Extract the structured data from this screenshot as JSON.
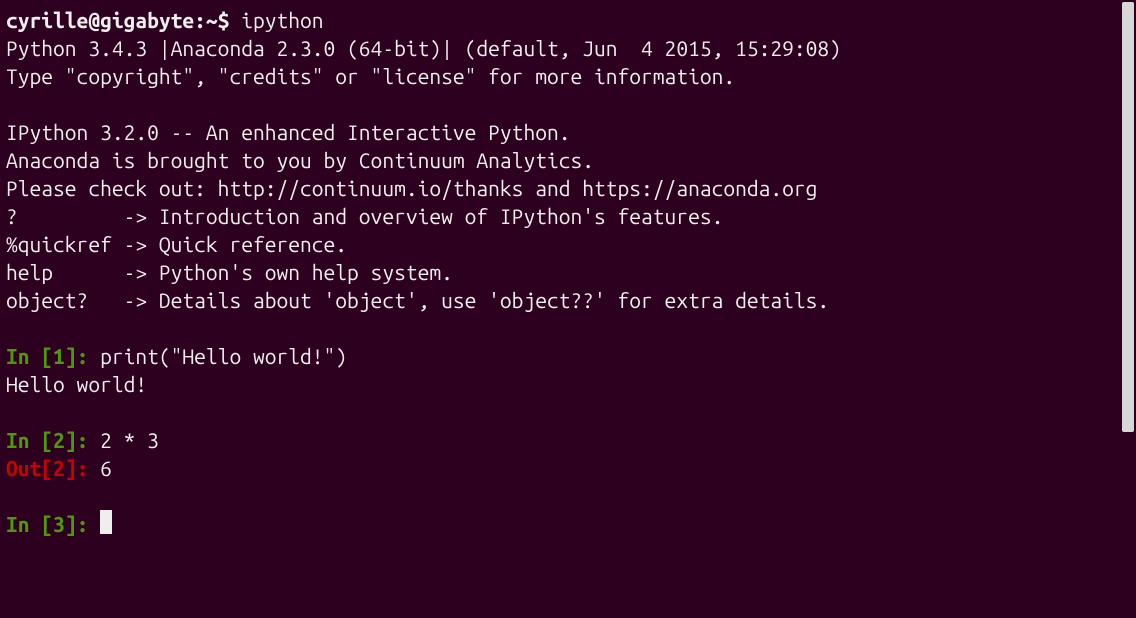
{
  "shell": {
    "prompt": "cyrille@gigabyte:~$ ",
    "command": "ipython"
  },
  "banner": {
    "line1": "Python 3.4.3 |Anaconda 2.3.0 (64-bit)| (default, Jun  4 2015, 15:29:08) ",
    "line2": "Type \"copyright\", \"credits\" or \"license\" for more information.",
    "blank1": "",
    "line3": "IPython 3.2.0 -- An enhanced Interactive Python.",
    "line4": "Anaconda is brought to you by Continuum Analytics.",
    "line5": "Please check out: http://continuum.io/thanks and https://anaconda.org",
    "line6": "?         -> Introduction and overview of IPython's features.",
    "line7": "%quickref -> Quick reference.",
    "line8": "help      -> Python's own help system.",
    "line9": "object?   -> Details about 'object', use 'object??' for extra details."
  },
  "cells": {
    "in1_prefix": "In [",
    "in1_num": "1",
    "in1_suffix": "]: ",
    "in1_code": "print(\"Hello world!\")",
    "out1_text": "Hello world!",
    "in2_prefix": "In [",
    "in2_num": "2",
    "in2_suffix": "]: ",
    "in2_code": "2 * 3",
    "out2_prefix": "Out[",
    "out2_num": "2",
    "out2_suffix": "]: ",
    "out2_val": "6",
    "in3_prefix": "In [",
    "in3_num": "3",
    "in3_suffix": "]: "
  }
}
